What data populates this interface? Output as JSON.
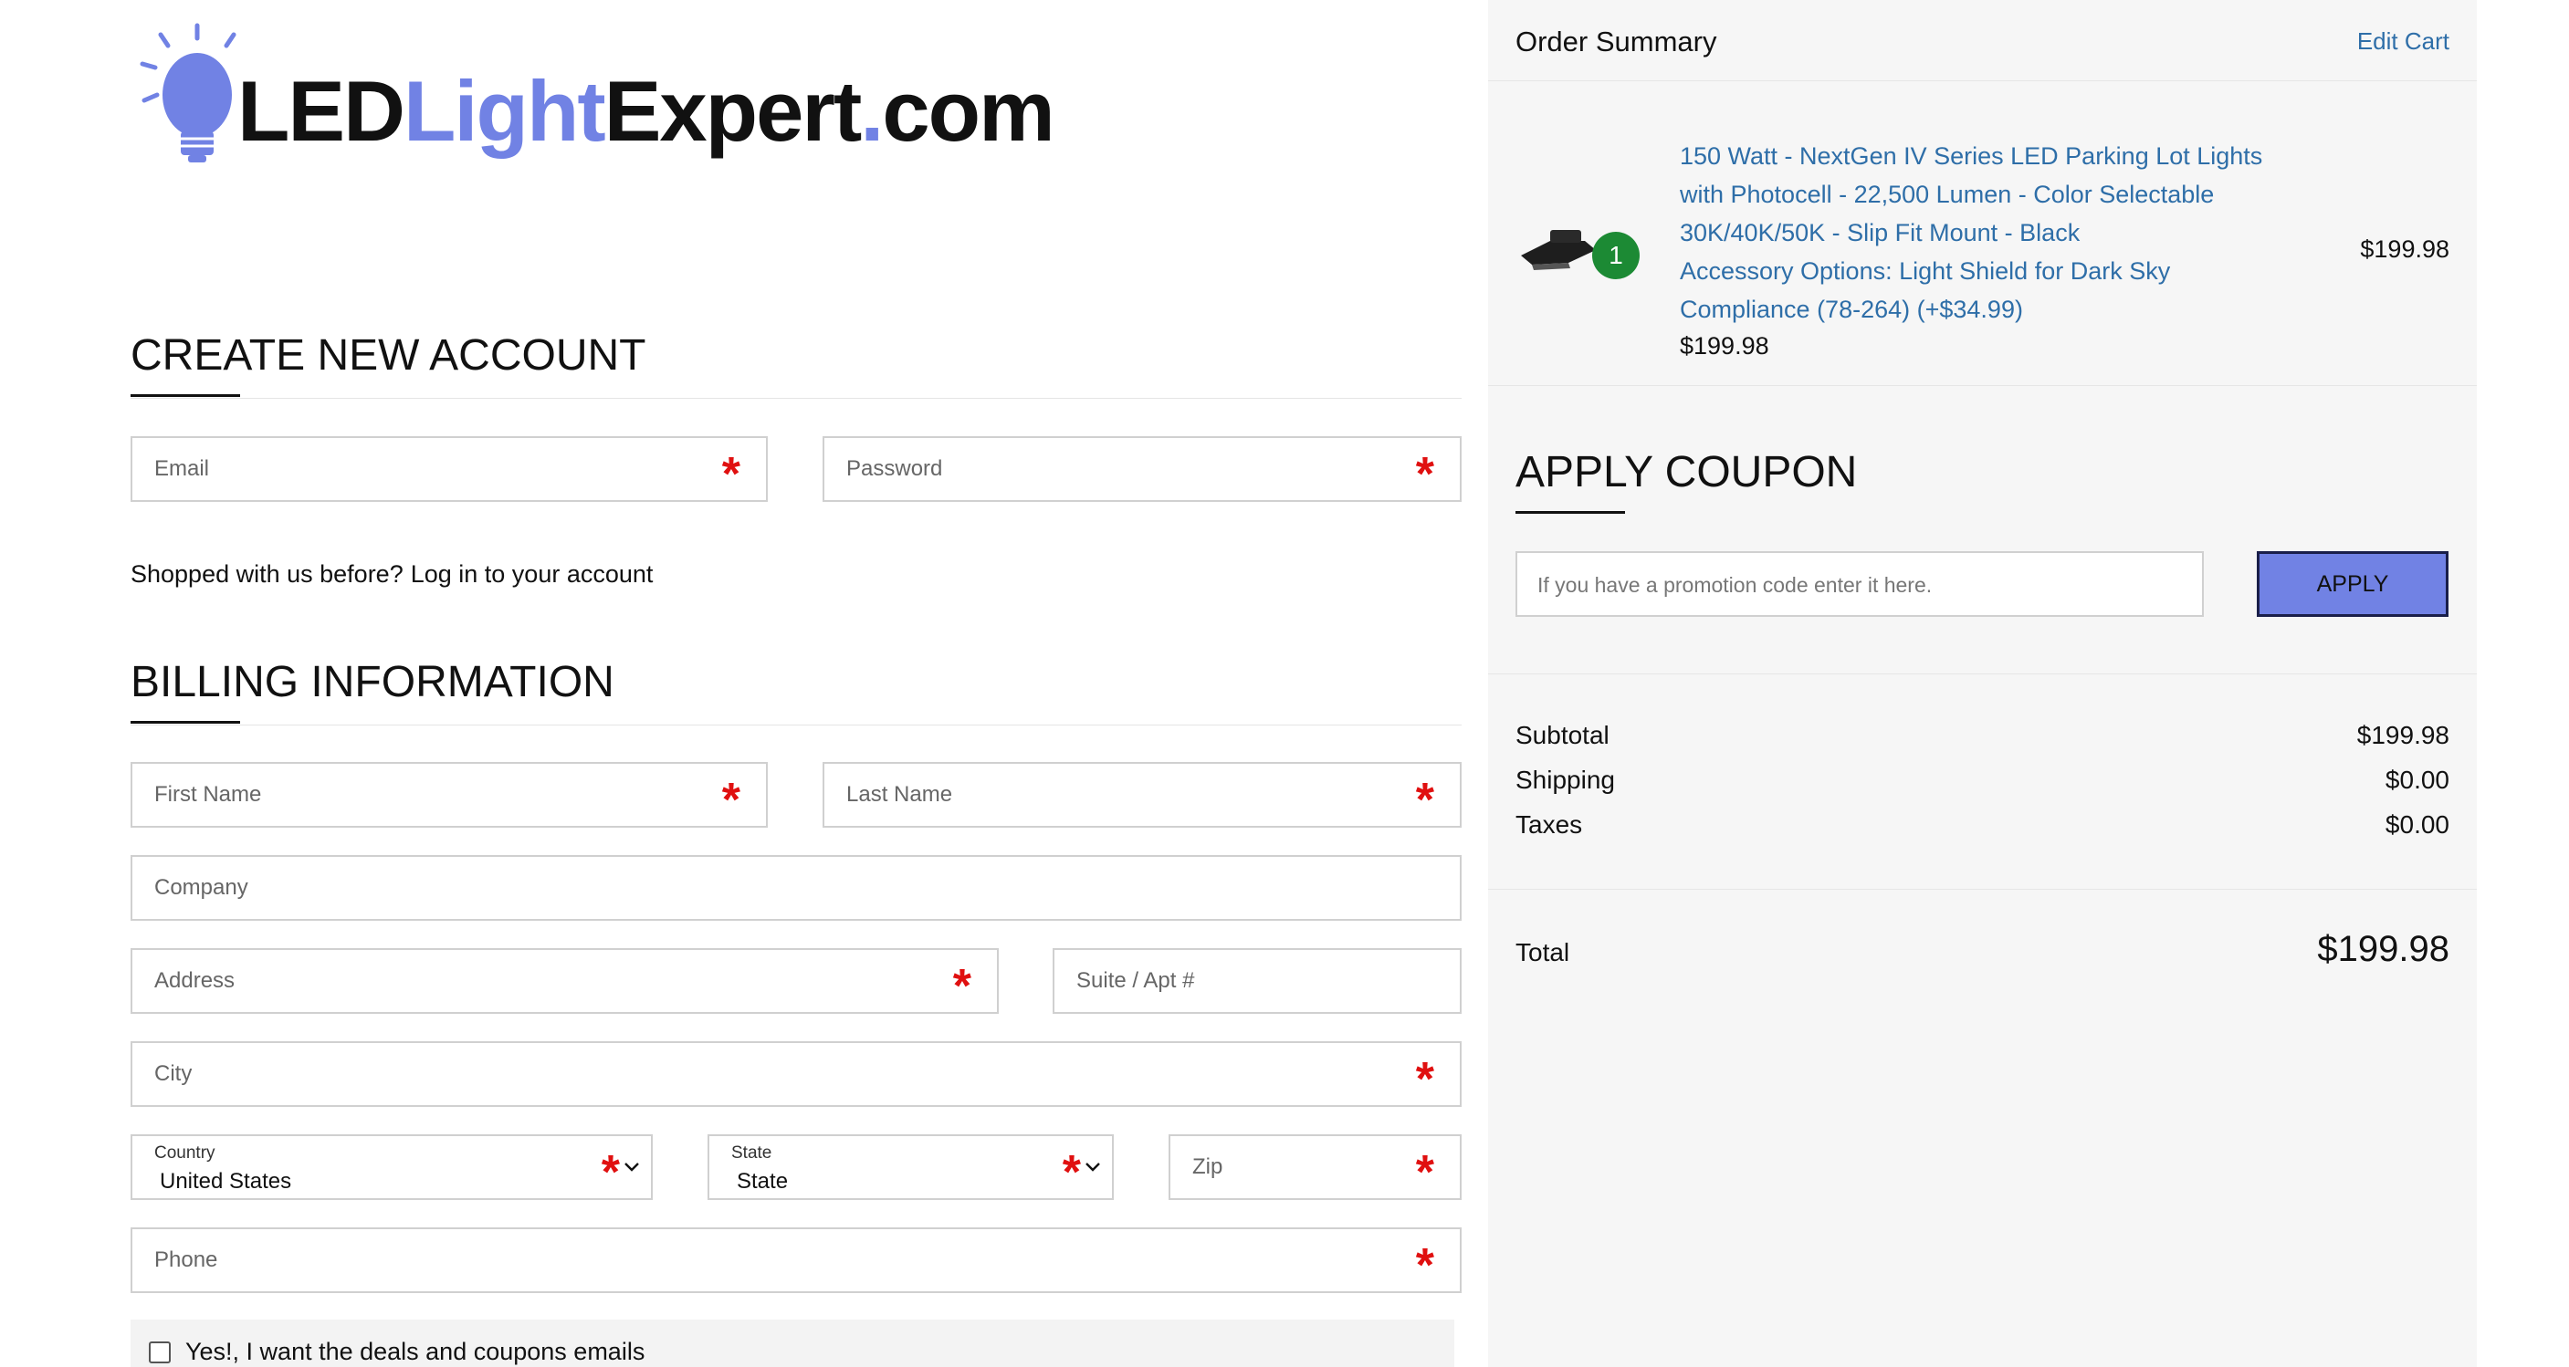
{
  "logo": {
    "part1": "LED",
    "part2": "Light",
    "part3": "Expert",
    "part4": ".",
    "part5": "com"
  },
  "account": {
    "title": "CREATE NEW ACCOUNT",
    "email_placeholder": "Email",
    "password_placeholder": "Password",
    "required_mark": "*",
    "shopped_before": "Shopped with us before?",
    "login_link": "Log in to your account"
  },
  "billing": {
    "title": "BILLING INFORMATION",
    "first_name": "First Name",
    "last_name": "Last Name",
    "company": "Company",
    "address": "Address",
    "suite": "Suite / Apt #",
    "city": "City",
    "country_label": "Country",
    "country_value": "United States",
    "state_label": "State",
    "state_value": "State",
    "zip": "Zip",
    "phone": "Phone",
    "optin_label": "Yes!, I want the deals and coupons emails"
  },
  "summary": {
    "title": "Order Summary",
    "edit_cart": "Edit Cart",
    "product": {
      "quantity": "1",
      "line1": "150 Watt - NextGen IV Series LED Parking Lot Lights",
      "line2": "with Photocell - 22,500 Lumen - Color Selectable",
      "line3": "30K/40K/50K - Slip Fit Mount - Black",
      "line4": "Accessory Options:  Light Shield for Dark Sky",
      "line5": "Compliance (78-264) (+$34.99)",
      "unit_price": "$199.98",
      "line_price": "$199.98"
    },
    "coupon": {
      "title": "APPLY COUPON",
      "placeholder": "If you have a promotion code enter it here.",
      "button": "APPLY"
    },
    "subtotal_label": "Subtotal",
    "subtotal_value": "$199.98",
    "shipping_label": "Shipping",
    "shipping_value": "$0.00",
    "taxes_label": "Taxes",
    "taxes_value": "$0.00",
    "total_label": "Total",
    "total_value": "$199.98"
  },
  "colors": {
    "accent": "#7182e4",
    "link": "#2e6ea8",
    "required": "#e01010",
    "badge": "#1c8a34",
    "panel_bg": "#f6f6f6"
  }
}
